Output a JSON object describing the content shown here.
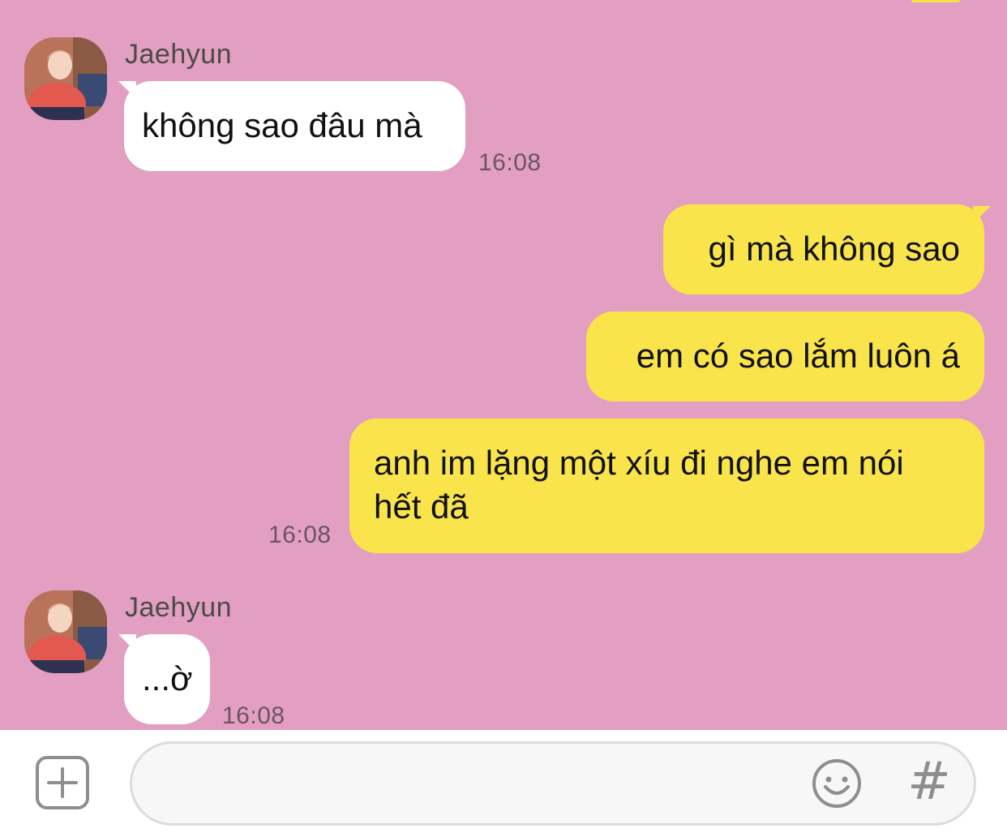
{
  "colors": {
    "chat_background": "#e39fc1",
    "incoming_bubble": "#ffffff",
    "outgoing_bubble": "#f9e44c",
    "timestamp": "#6b5560"
  },
  "messages": [
    {
      "sender": "Jaehyun",
      "direction": "incoming",
      "text": "không sao đâu mà",
      "time": "16:08"
    },
    {
      "direction": "outgoing",
      "text": "gì mà không sao"
    },
    {
      "direction": "outgoing",
      "text": "em có sao lắm luôn á"
    },
    {
      "direction": "outgoing",
      "text": "anh im lặng một xíu đi nghe em nói hết đã",
      "time": "16:08"
    },
    {
      "sender": "Jaehyun",
      "direction": "incoming",
      "text": "...ờ",
      "time": "16:08"
    }
  ],
  "input_bar": {
    "attach_icon": "plus-square-icon",
    "message_value": "",
    "emoji_icon": "smiley-icon",
    "hashtag_label": "#"
  }
}
